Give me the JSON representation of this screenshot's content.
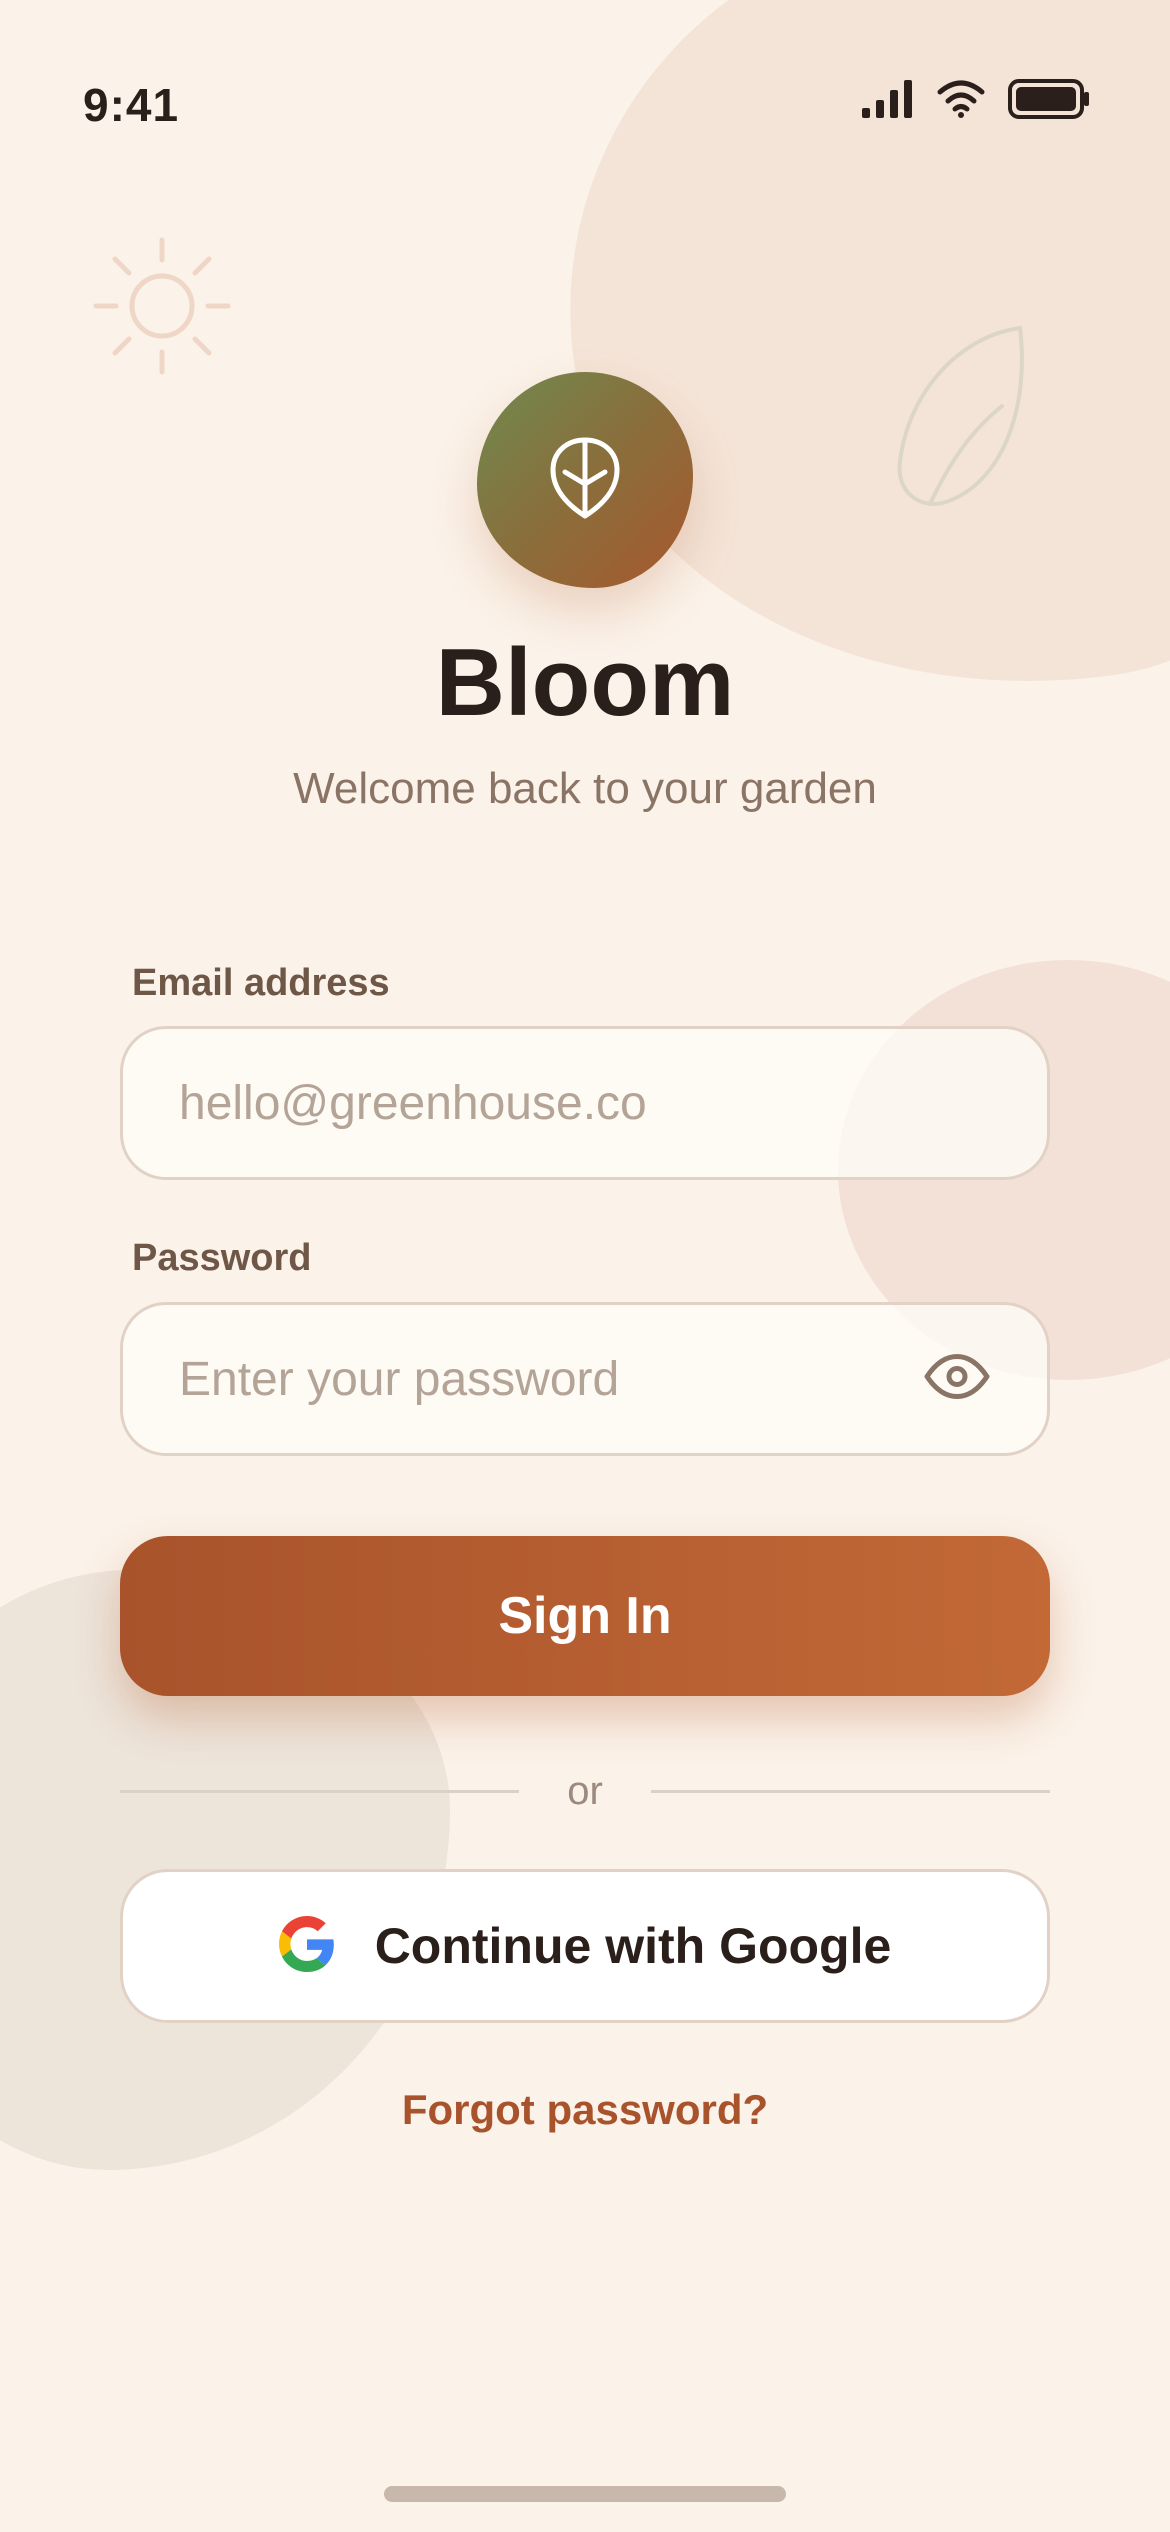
{
  "status_bar": {
    "time": "9:41",
    "icons": [
      "signal-icon",
      "wifi-icon",
      "battery-icon"
    ]
  },
  "decorations": [
    "sun-icon",
    "leaf-outline-icon"
  ],
  "app": {
    "logo_icon": "leaf-icon",
    "name": "Bloom",
    "tagline": "Welcome back to your garden"
  },
  "form": {
    "email": {
      "label": "Email address",
      "placeholder": "hello@greenhouse.co",
      "value": ""
    },
    "password": {
      "label": "Password",
      "placeholder": "Enter your password",
      "value": "",
      "toggle_icon": "eye-icon"
    },
    "sign_in_label": "Sign In",
    "divider_text": "or",
    "google_label": "Continue with Google",
    "google_icon": "google-logo-icon",
    "forgot_label": "Forgot password?"
  },
  "colors": {
    "background": "#fbf2e9",
    "primary": "#b25e30",
    "primary_dark": "#a9532c",
    "logo_green": "#6f8a4f",
    "text_dark": "#2a1f1a",
    "text_muted": "#8a7466",
    "border": "#e2d2c6"
  }
}
